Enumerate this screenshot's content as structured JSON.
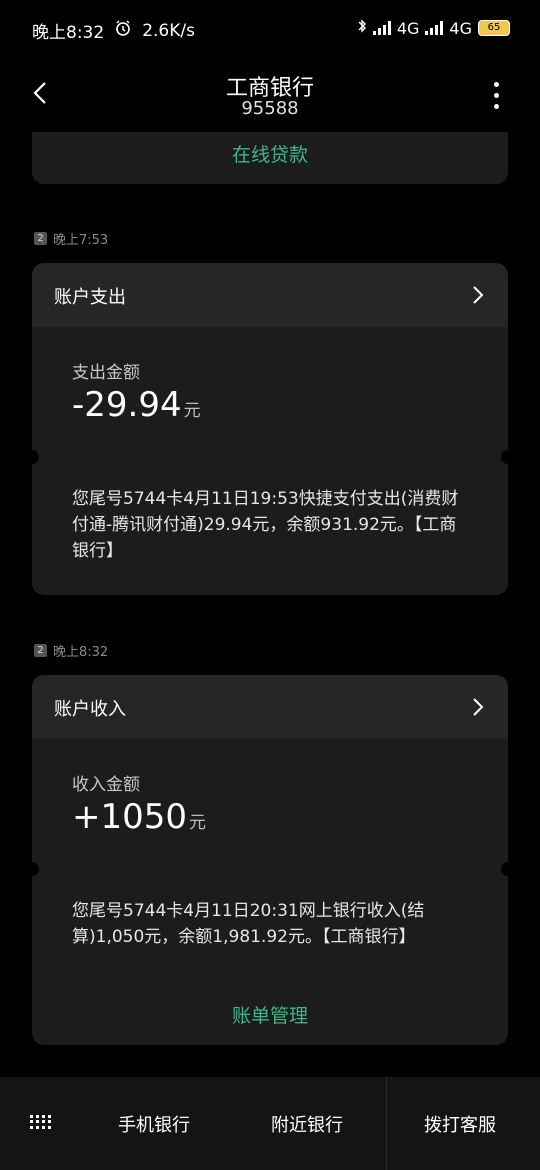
{
  "status_bar": {
    "time": "晚上8:32",
    "net_speed": "2.6K/s",
    "network_1": "4G",
    "network_2": "4G",
    "battery": "65"
  },
  "header": {
    "title": "工商银行",
    "subtitle": "95588"
  },
  "top_card": {
    "link": "在线贷款"
  },
  "messages": [
    {
      "sim": "2",
      "time": "晚上7:53",
      "header_label": "账户支出",
      "amount_label": "支出金额",
      "amount": "-29.94",
      "unit": "元",
      "text": "您尾号5744卡4月11日19:53快捷支付支出(消费财付通-腾讯财付通)29.94元，余额931.92元。【工商银行】"
    },
    {
      "sim": "2",
      "time": "晚上8:32",
      "header_label": "账户收入",
      "amount_label": "收入金额",
      "amount": "+1050",
      "unit": "元",
      "text": "您尾号5744卡4月11日20:31网上银行收入(结算)1,050元，余额1,981.92元。【工商银行】",
      "link": "账单管理"
    }
  ],
  "bottom_nav": {
    "item_1": "手机银行",
    "item_2": "附近银行",
    "item_3": "拨打客服"
  }
}
